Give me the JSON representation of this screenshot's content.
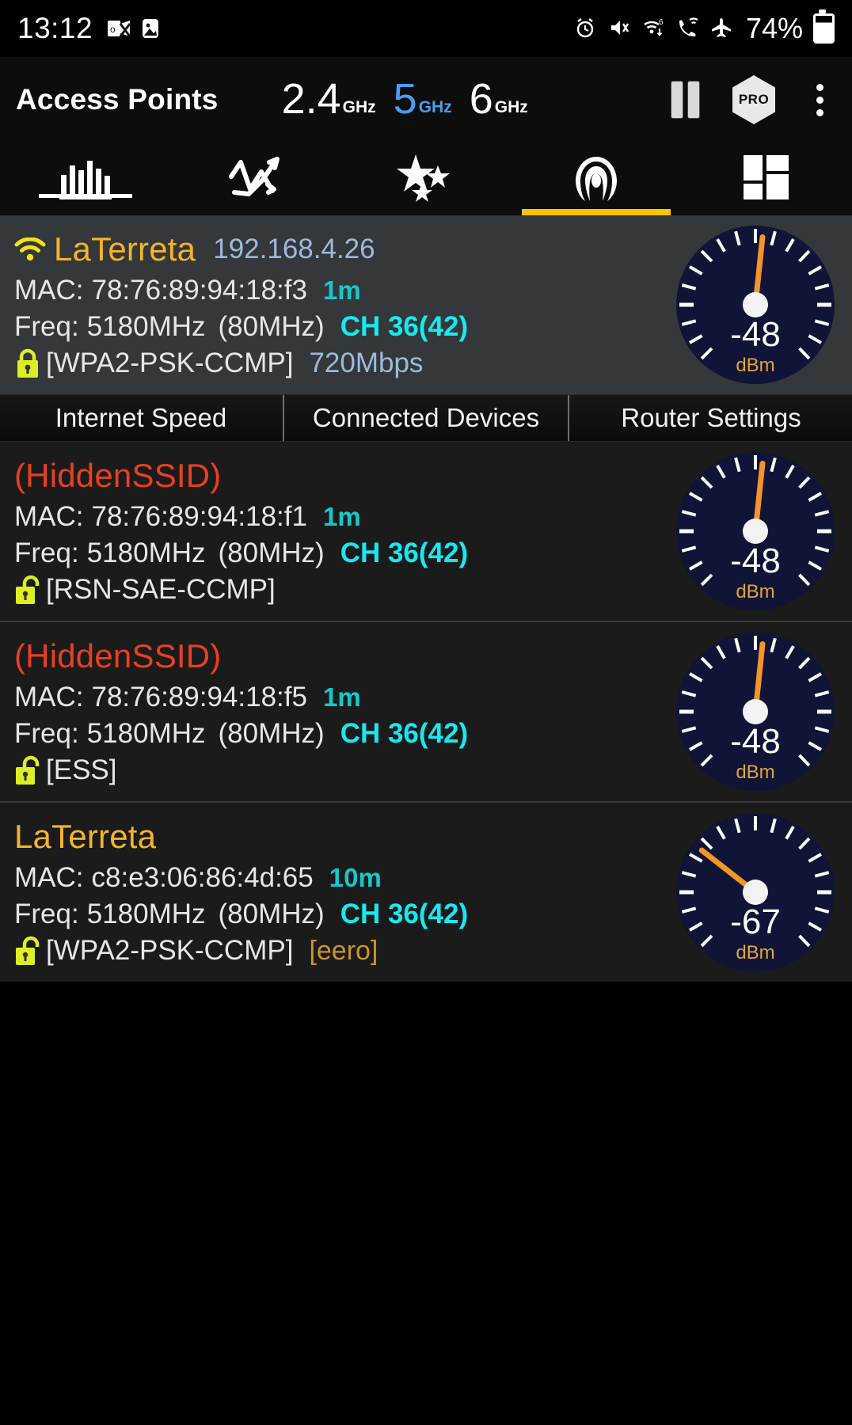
{
  "status_bar": {
    "time": "13:12",
    "left_icons": [
      "outlook-icon",
      "gallery-icon"
    ],
    "right_icons": [
      "alarm-icon",
      "mute-icon",
      "wifi-6-icon",
      "call-wifi-icon",
      "airplane-mode-icon"
    ],
    "battery_percent": "74%"
  },
  "header": {
    "title": "Access Points",
    "bands": [
      {
        "num": "2.4",
        "unit": "GHz",
        "active": false
      },
      {
        "num": "5",
        "unit": "GHz",
        "active": true
      },
      {
        "num": "6",
        "unit": "GHz",
        "active": false
      }
    ],
    "pause_label": "pause-icon",
    "pro_label": "PRO",
    "overflow_label": "more-options-icon"
  },
  "tabs": [
    {
      "name": "channel-graph",
      "icon": "bar-chart-icon",
      "selected": false
    },
    {
      "name": "time-graph",
      "icon": "line-chart-icon",
      "selected": false
    },
    {
      "name": "favorites",
      "icon": "stars-icon",
      "selected": false
    },
    {
      "name": "access-points",
      "icon": "access-point-radar-icon",
      "selected": true
    },
    {
      "name": "dashboard",
      "icon": "grid-layout-icon",
      "selected": false
    }
  ],
  "accent_colors": {
    "ssid": "#f5b32a",
    "hidden_ssid": "#e8401f",
    "channel": "#19e8f0",
    "distance": "#18c8c8",
    "ip": "#9fb8dd",
    "link_speed": "#9fb8dd",
    "vendor": "#c9952c",
    "tab_indicator": "#ffc400",
    "band_active": "#4a9eed",
    "gauge_face": "#101436",
    "gauge_needle": "#f59428",
    "lock": "#ddee22"
  },
  "access_points": [
    {
      "ssid": "LaTerreta",
      "hidden": false,
      "connected": true,
      "ip": "192.168.4.26",
      "mac_label": "MAC:",
      "mac": "78:76:89:94:18:f3",
      "distance": "1m",
      "freq_label": "Freq:",
      "freq": "5180MHz",
      "width": "(80MHz)",
      "channel": "CH 36(42)",
      "security": "[WPA2-PSK-CCMP]",
      "locked": true,
      "link_speed": "720Mbps",
      "vendor": "",
      "signal": "-48",
      "unit": "dBm",
      "needle_angle": 6
    },
    {
      "ssid": "(HiddenSSID)",
      "hidden": true,
      "connected": false,
      "ip": "",
      "mac_label": "MAC:",
      "mac": "78:76:89:94:18:f1",
      "distance": "1m",
      "freq_label": "Freq:",
      "freq": "5180MHz",
      "width": "(80MHz)",
      "channel": "CH 36(42)",
      "security": "[RSN-SAE-CCMP]",
      "locked": false,
      "link_speed": "",
      "vendor": "",
      "signal": "-48",
      "unit": "dBm",
      "needle_angle": 6
    },
    {
      "ssid": "(HiddenSSID)",
      "hidden": true,
      "connected": false,
      "ip": "",
      "mac_label": "MAC:",
      "mac": "78:76:89:94:18:f5",
      "distance": "1m",
      "freq_label": "Freq:",
      "freq": "5180MHz",
      "width": "(80MHz)",
      "channel": "CH 36(42)",
      "security": "[ESS]",
      "locked": false,
      "link_speed": "",
      "vendor": "",
      "signal": "-48",
      "unit": "dBm",
      "needle_angle": 6
    },
    {
      "ssid": "LaTerreta",
      "hidden": false,
      "connected": false,
      "ip": "",
      "mac_label": "MAC:",
      "mac": "c8:e3:06:86:4d:65",
      "distance": "10m",
      "freq_label": "Freq:",
      "freq": "5180MHz",
      "width": "(80MHz)",
      "channel": "CH 36(42)",
      "security": "[WPA2-PSK-CCMP]",
      "locked": false,
      "link_speed": "",
      "vendor": "[eero]",
      "signal": "-67",
      "unit": "dBm",
      "needle_angle": -52
    }
  ],
  "action_buttons": [
    {
      "label": "Internet Speed",
      "name": "internet-speed-button"
    },
    {
      "label": "Connected Devices",
      "name": "connected-devices-button"
    },
    {
      "label": "Router Settings",
      "name": "router-settings-button"
    }
  ]
}
